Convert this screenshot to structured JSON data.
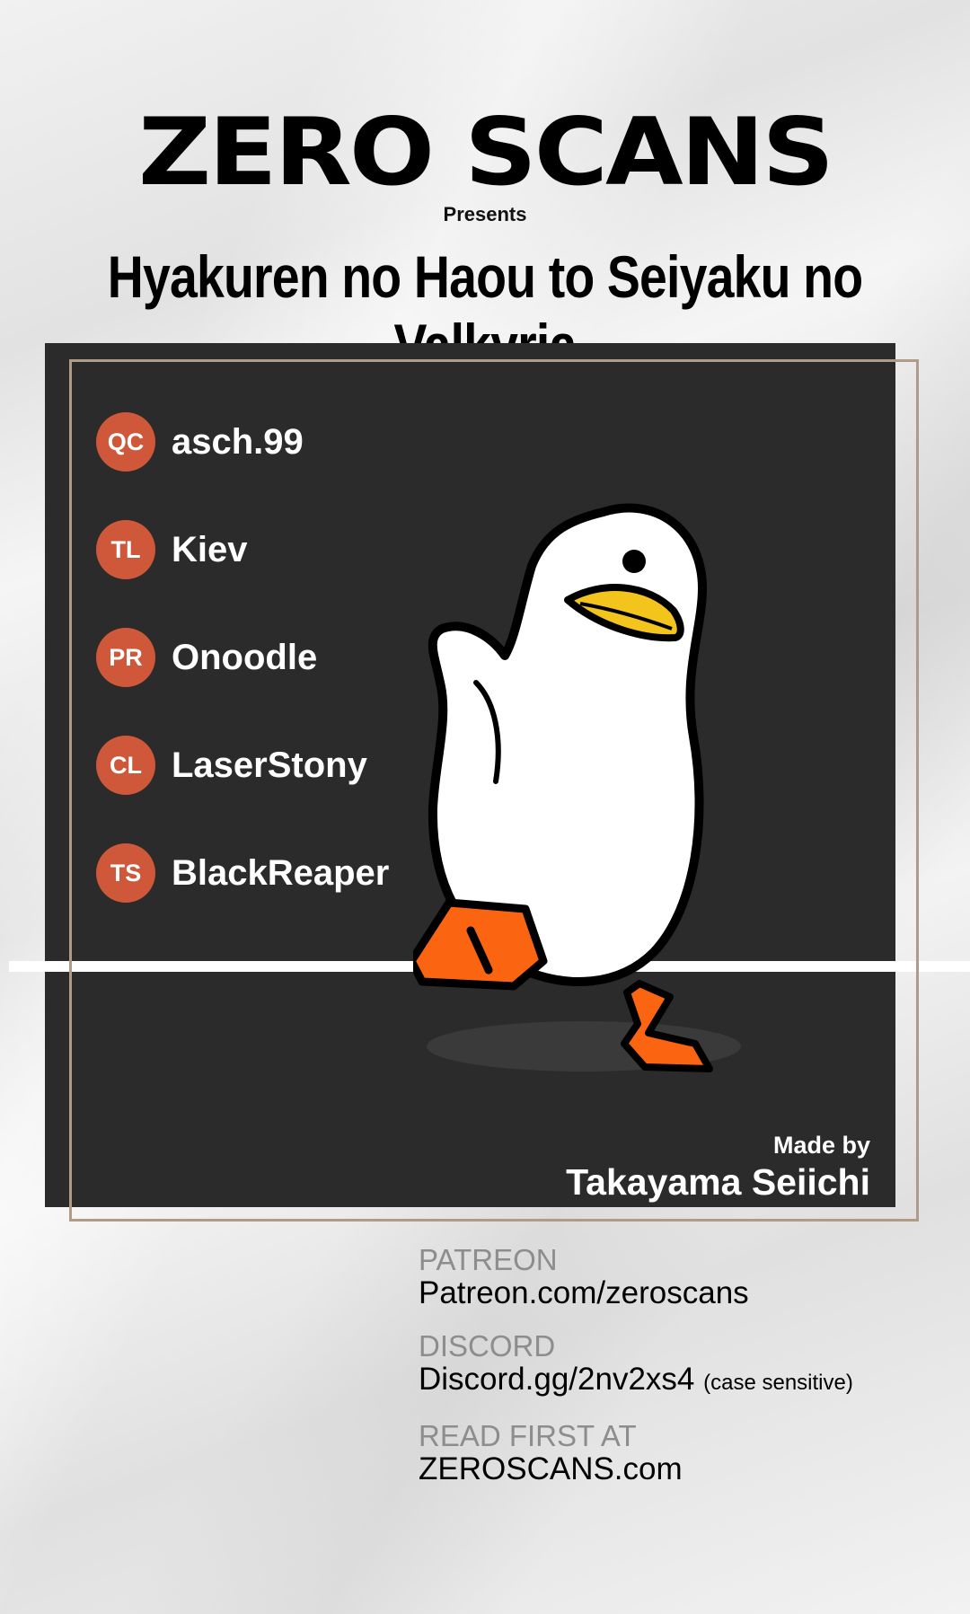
{
  "brand": "ZERO SCANS",
  "presents": "Presents",
  "series_title": "Hyakuren no Haou to Seiyaku no Valkyria",
  "staff": [
    {
      "role": "QC",
      "name": "asch.99"
    },
    {
      "role": "TL",
      "name": "Kiev"
    },
    {
      "role": "PR",
      "name": "Onoodle"
    },
    {
      "role": "CL",
      "name": "LaserStony"
    },
    {
      "role": "TS",
      "name": "BlackReaper"
    }
  ],
  "credit": {
    "label": "Made by",
    "name": "Takayama Seiichi"
  },
  "links": [
    {
      "label": "PATREON",
      "value": "Patreon.com/zeroscans",
      "note": ""
    },
    {
      "label": "DISCORD",
      "value": "Discord.gg/2nv2xs4",
      "note": "(case sensitive)"
    },
    {
      "label": "READ FIRST AT",
      "value": "ZEROSCANS.com",
      "note": ""
    }
  ],
  "colors": {
    "panel": "#2b2b2b",
    "badge": "#d0583a",
    "frame": "#b09a88",
    "link_label": "#8d8d8d",
    "duck_beak": "#f2c41c",
    "duck_feet": "#fb6410"
  },
  "icons": {
    "mascot": "duck-illustration"
  }
}
